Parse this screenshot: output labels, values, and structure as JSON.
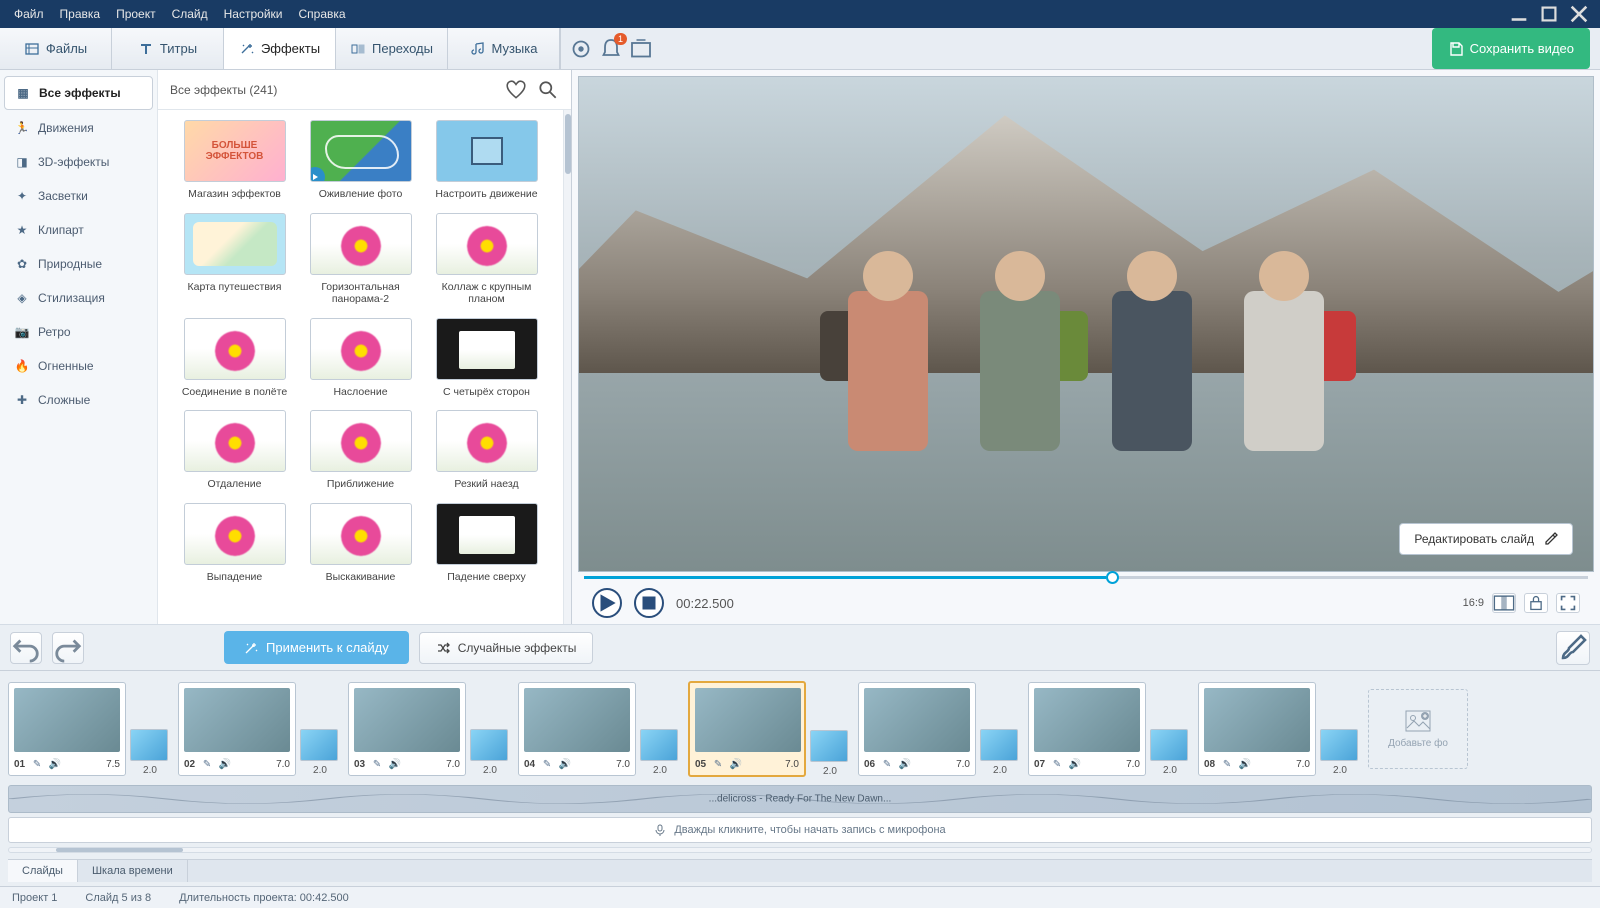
{
  "menu": [
    "Файл",
    "Правка",
    "Проект",
    "Слайд",
    "Настройки",
    "Справка"
  ],
  "tabs": [
    {
      "label": "Файлы",
      "icon": "files"
    },
    {
      "label": "Титры",
      "icon": "titles"
    },
    {
      "label": "Эффекты",
      "icon": "effects"
    },
    {
      "label": "Переходы",
      "icon": "transitions"
    },
    {
      "label": "Музыка",
      "icon": "music"
    }
  ],
  "active_tab": 2,
  "notification_badge": "1",
  "save_label": "Сохранить видео",
  "categories": [
    {
      "label": "Все эффекты",
      "icon": "grid"
    },
    {
      "label": "Движения",
      "icon": "run"
    },
    {
      "label": "3D-эффекты",
      "icon": "cube"
    },
    {
      "label": "Засветки",
      "icon": "sparkle"
    },
    {
      "label": "Клипарт",
      "icon": "star"
    },
    {
      "label": "Природные",
      "icon": "leaf"
    },
    {
      "label": "Стилизация",
      "icon": "camera"
    },
    {
      "label": "Ретро",
      "icon": "camera2"
    },
    {
      "label": "Огненные",
      "icon": "fire"
    },
    {
      "label": "Сложные",
      "icon": "puzzle"
    }
  ],
  "active_category": 0,
  "effects_header": "Все эффекты (241)",
  "effects": [
    {
      "label": "Магазин эффектов",
      "kind": "more",
      "text": "БОЛЬШЕ\nЭФФЕКТОВ"
    },
    {
      "label": "Оживление фото",
      "kind": "flow",
      "play": true
    },
    {
      "label": "Настроить движение",
      "kind": "blue"
    },
    {
      "label": "Карта путешествия",
      "kind": "map"
    },
    {
      "label": "Горизонтальная панорама-2",
      "kind": "flower"
    },
    {
      "label": "Коллаж с крупным планом",
      "kind": "flower"
    },
    {
      "label": "Соединение в полёте",
      "kind": "flower"
    },
    {
      "label": "Наслоение",
      "kind": "flower"
    },
    {
      "label": "С четырёх сторон",
      "kind": "dark"
    },
    {
      "label": "Отдаление",
      "kind": "flower"
    },
    {
      "label": "Приближение",
      "kind": "flower"
    },
    {
      "label": "Резкий наезд",
      "kind": "flower"
    },
    {
      "label": "Выпадение",
      "kind": "flower"
    },
    {
      "label": "Выскакивание",
      "kind": "flower"
    },
    {
      "label": "Падение сверху",
      "kind": "dark"
    }
  ],
  "edit_slide_label": "Редактировать слайд",
  "apply_label": "Применить к слайду",
  "random_label": "Случайные эффекты",
  "timecode": "00:22.500",
  "aspect": "16:9",
  "slides": [
    {
      "num": "01",
      "dur": "7.5"
    },
    {
      "num": "02",
      "dur": "7.0"
    },
    {
      "num": "03",
      "dur": "7.0"
    },
    {
      "num": "04",
      "dur": "7.0"
    },
    {
      "num": "05",
      "dur": "7.0",
      "selected": true
    },
    {
      "num": "06",
      "dur": "7.0"
    },
    {
      "num": "07",
      "dur": "7.0"
    },
    {
      "num": "08",
      "dur": "7.0"
    }
  ],
  "trans_dur": "2.0",
  "add_photo": "Добавьте фо",
  "audio_track_label": "...delicross - Ready For The New Dawn...",
  "record_hint": "Дважды кликните, чтобы начать запись с микрофона",
  "view_tabs": [
    "Слайды",
    "Шкала времени"
  ],
  "active_view": 0,
  "status": {
    "project": "Проект 1",
    "slide": "Слайд 5 из 8",
    "duration": "Длительность проекта: 00:42.500"
  }
}
